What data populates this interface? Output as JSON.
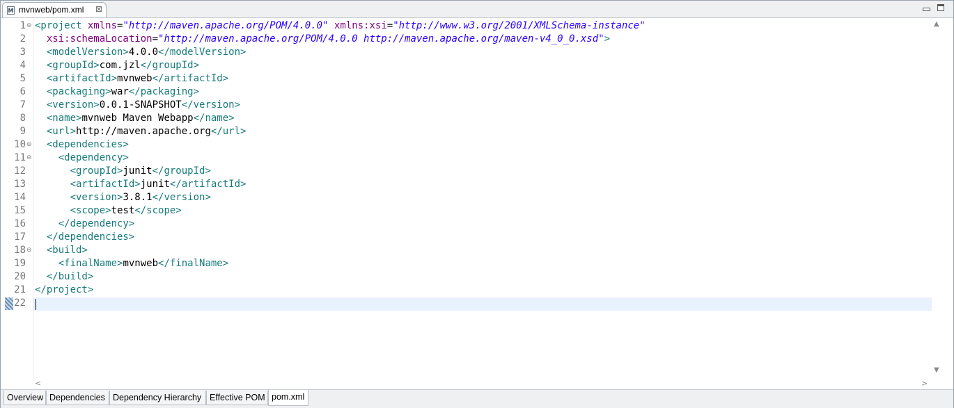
{
  "editor_tab": {
    "title": "mvnweb/pom.xml",
    "icon": "xml-file-icon",
    "close_glyph": "⊠"
  },
  "code_lines": [
    [
      [
        "tg",
        "<project "
      ],
      [
        "an",
        "xmlns"
      ],
      [
        "tx",
        "="
      ],
      [
        "av",
        "\"http://maven.apache.org/POM/4.0.0\""
      ],
      [
        "tx",
        " "
      ],
      [
        "an",
        "xmlns:xsi"
      ],
      [
        "tx",
        "="
      ],
      [
        "av",
        "\"http://www.w3.org/2001/XMLSchema-instance\""
      ]
    ],
    [
      [
        "tx",
        "  "
      ],
      [
        "an",
        "xsi:schemaLocation"
      ],
      [
        "tx",
        "="
      ],
      [
        "av",
        "\"http://maven.apache.org/POM/4.0.0 http://maven.apache.org/maven-v4_0_0.xsd\""
      ],
      [
        "tg",
        ">"
      ]
    ],
    [
      [
        "tx",
        "  "
      ],
      [
        "tg",
        "<modelVersion>"
      ],
      [
        "tx",
        "4.0.0"
      ],
      [
        "tg",
        "</modelVersion>"
      ]
    ],
    [
      [
        "tx",
        "  "
      ],
      [
        "tg",
        "<groupId>"
      ],
      [
        "tx",
        "com.jzl"
      ],
      [
        "tg",
        "</groupId>"
      ]
    ],
    [
      [
        "tx",
        "  "
      ],
      [
        "tg",
        "<artifactId>"
      ],
      [
        "tx",
        "mvnweb"
      ],
      [
        "tg",
        "</artifactId>"
      ]
    ],
    [
      [
        "tx",
        "  "
      ],
      [
        "tg",
        "<packaging>"
      ],
      [
        "tx",
        "war"
      ],
      [
        "tg",
        "</packaging>"
      ]
    ],
    [
      [
        "tx",
        "  "
      ],
      [
        "tg",
        "<version>"
      ],
      [
        "tx",
        "0.0.1-SNAPSHOT"
      ],
      [
        "tg",
        "</version>"
      ]
    ],
    [
      [
        "tx",
        "  "
      ],
      [
        "tg",
        "<name>"
      ],
      [
        "tx",
        "mvnweb Maven Webapp"
      ],
      [
        "tg",
        "</name>"
      ]
    ],
    [
      [
        "tx",
        "  "
      ],
      [
        "tg",
        "<url>"
      ],
      [
        "tx",
        "http://maven.apache.org"
      ],
      [
        "tg",
        "</url>"
      ]
    ],
    [
      [
        "tx",
        "  "
      ],
      [
        "tg",
        "<dependencies>"
      ]
    ],
    [
      [
        "tx",
        "    "
      ],
      [
        "tg",
        "<dependency>"
      ]
    ],
    [
      [
        "tx",
        "      "
      ],
      [
        "tg",
        "<groupId>"
      ],
      [
        "tx",
        "junit"
      ],
      [
        "tg",
        "</groupId>"
      ]
    ],
    [
      [
        "tx",
        "      "
      ],
      [
        "tg",
        "<artifactId>"
      ],
      [
        "tx",
        "junit"
      ],
      [
        "tg",
        "</artifactId>"
      ]
    ],
    [
      [
        "tx",
        "      "
      ],
      [
        "tg",
        "<version>"
      ],
      [
        "tx",
        "3.8.1"
      ],
      [
        "tg",
        "</version>"
      ]
    ],
    [
      [
        "tx",
        "      "
      ],
      [
        "tg",
        "<scope>"
      ],
      [
        "tx",
        "test"
      ],
      [
        "tg",
        "</scope>"
      ]
    ],
    [
      [
        "tx",
        "    "
      ],
      [
        "tg",
        "</dependency>"
      ]
    ],
    [
      [
        "tx",
        "  "
      ],
      [
        "tg",
        "</dependencies>"
      ]
    ],
    [
      [
        "tx",
        "  "
      ],
      [
        "tg",
        "<build>"
      ]
    ],
    [
      [
        "tx",
        "    "
      ],
      [
        "tg",
        "<finalName>"
      ],
      [
        "tx",
        "mvnweb"
      ],
      [
        "tg",
        "</finalName>"
      ]
    ],
    [
      [
        "tx",
        "  "
      ],
      [
        "tg",
        "</build>"
      ]
    ],
    [
      [
        "tg",
        "</project>"
      ]
    ],
    []
  ],
  "line_numbers": [
    "1",
    "2",
    "3",
    "4",
    "5",
    "6",
    "7",
    "8",
    "9",
    "10",
    "11",
    "12",
    "13",
    "14",
    "15",
    "16",
    "17",
    "18",
    "19",
    "20",
    "21",
    "22"
  ],
  "fold_markers": [
    "1",
    "10",
    "11",
    "18"
  ],
  "fold_glyph": "⊖",
  "current_line": "22",
  "syntax_colors": {
    "tag": "#177a7a",
    "attribute_name": "#7f007f",
    "attribute_value": "#2a00ff",
    "text": "#000000",
    "current_line_bg": "#e8f2fe"
  },
  "scrollbar": {
    "up_icon": "▲",
    "down_icon": "▼",
    "left_icon": "<",
    "right_icon": ">"
  },
  "bottom_tabs": [
    {
      "label": "Overview",
      "active": false
    },
    {
      "label": "Dependencies",
      "active": false
    },
    {
      "label": "Dependency Hierarchy",
      "active": false
    },
    {
      "label": "Effective POM",
      "active": false
    },
    {
      "label": "pom.xml",
      "active": true
    }
  ]
}
